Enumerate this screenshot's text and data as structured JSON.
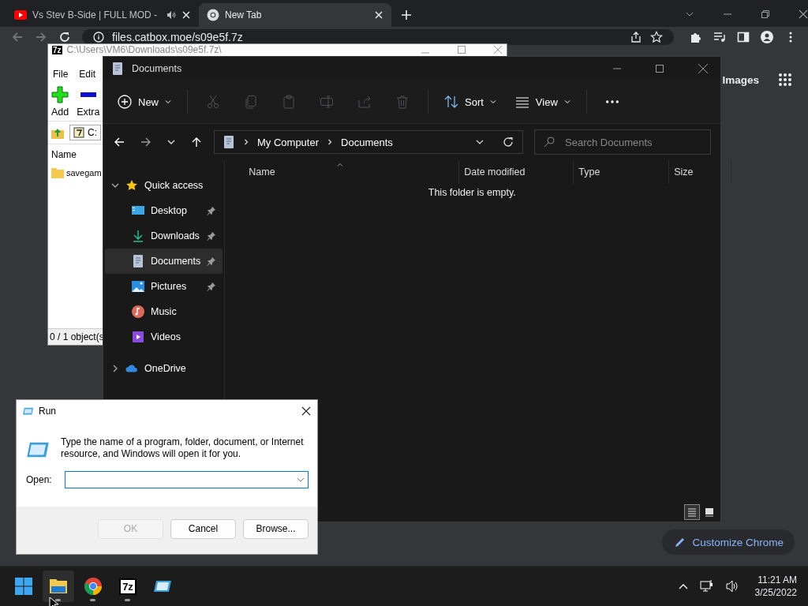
{
  "browser": {
    "tabs": [
      {
        "title": "Vs Stev B-Side | FULL MOD -",
        "kind": "video",
        "audio": true,
        "selected": false
      },
      {
        "title": "New Tab",
        "kind": "newtab",
        "audio": false,
        "selected": true
      }
    ],
    "address": "files.catbox.moe/s09e5f.7z",
    "images_link": "Images",
    "customize_button": "Customize Chrome"
  },
  "archiver": {
    "icon_text": "7z",
    "title": "C:\\Users\\VM6\\Downloads\\s09e5f.7z\\",
    "menu": [
      "File",
      "Edit"
    ],
    "tools": [
      {
        "kind": "add",
        "label": "Add"
      },
      {
        "kind": "extract",
        "label": "Extra"
      }
    ],
    "path": "C:",
    "columns": [
      "Name"
    ],
    "items": [
      "savegam"
    ],
    "status": "0 / 1 object(s"
  },
  "explorer": {
    "title": "Documents",
    "toolbar": [
      {
        "kind": "new",
        "label": "New",
        "disabled": false
      },
      {
        "kind": "cut",
        "disabled": true
      },
      {
        "kind": "copy",
        "disabled": true
      },
      {
        "kind": "paste",
        "disabled": true
      },
      {
        "kind": "rename",
        "disabled": true
      },
      {
        "kind": "share",
        "disabled": true
      },
      {
        "kind": "delete",
        "disabled": true
      },
      {
        "kind": "sort",
        "label": "Sort",
        "disabled": false
      },
      {
        "kind": "view",
        "label": "View",
        "disabled": false
      },
      {
        "kind": "more",
        "disabled": false
      }
    ],
    "breadcrumb": [
      "My Computer",
      "Documents"
    ],
    "search": {
      "placeholder": "Search Documents"
    },
    "nav": [
      {
        "label": "Quick access",
        "kind": "star",
        "expanded": true,
        "selected": false,
        "children": [
          {
            "label": "Desktop",
            "kind": "desktop",
            "pinned": true,
            "selected": false
          },
          {
            "label": "Downloads",
            "kind": "download",
            "pinned": true,
            "selected": false
          },
          {
            "label": "Documents",
            "kind": "document",
            "pinned": true,
            "selected": true
          },
          {
            "label": "Pictures",
            "kind": "pictures",
            "pinned": true,
            "selected": false
          },
          {
            "label": "Music",
            "kind": "music",
            "pinned": false,
            "selected": false
          },
          {
            "label": "Videos",
            "kind": "videos",
            "pinned": false,
            "selected": false
          }
        ]
      },
      {
        "label": "OneDrive",
        "kind": "cloud",
        "expanded": false,
        "selected": false
      }
    ],
    "columns": [
      "Name",
      "Date modified",
      "Type",
      "Size"
    ],
    "empty_message": "This folder is empty.",
    "views": [
      {
        "kind": "details",
        "selected": true
      },
      {
        "kind": "tiles",
        "selected": false
      }
    ]
  },
  "run": {
    "title": "Run",
    "message": "Type the name of a program, folder, document, or Internet resource, and Windows will open it for you.",
    "open_label": "Open:",
    "buttons": [
      {
        "label": "OK",
        "disabled": true
      },
      {
        "label": "Cancel",
        "disabled": false
      },
      {
        "label": "Browse...",
        "disabled": false
      }
    ]
  },
  "taskbar": {
    "apps": [
      {
        "kind": "start",
        "running": false,
        "active": false
      },
      {
        "kind": "folder",
        "running": true,
        "active": true
      },
      {
        "kind": "chrome",
        "running": true,
        "active": false
      },
      {
        "kind": "sevenzip",
        "label": "7z",
        "running": true,
        "active": false
      },
      {
        "kind": "run",
        "running": false,
        "active": false
      }
    ],
    "time": "11:21 AM",
    "date": "3/25/2022"
  }
}
